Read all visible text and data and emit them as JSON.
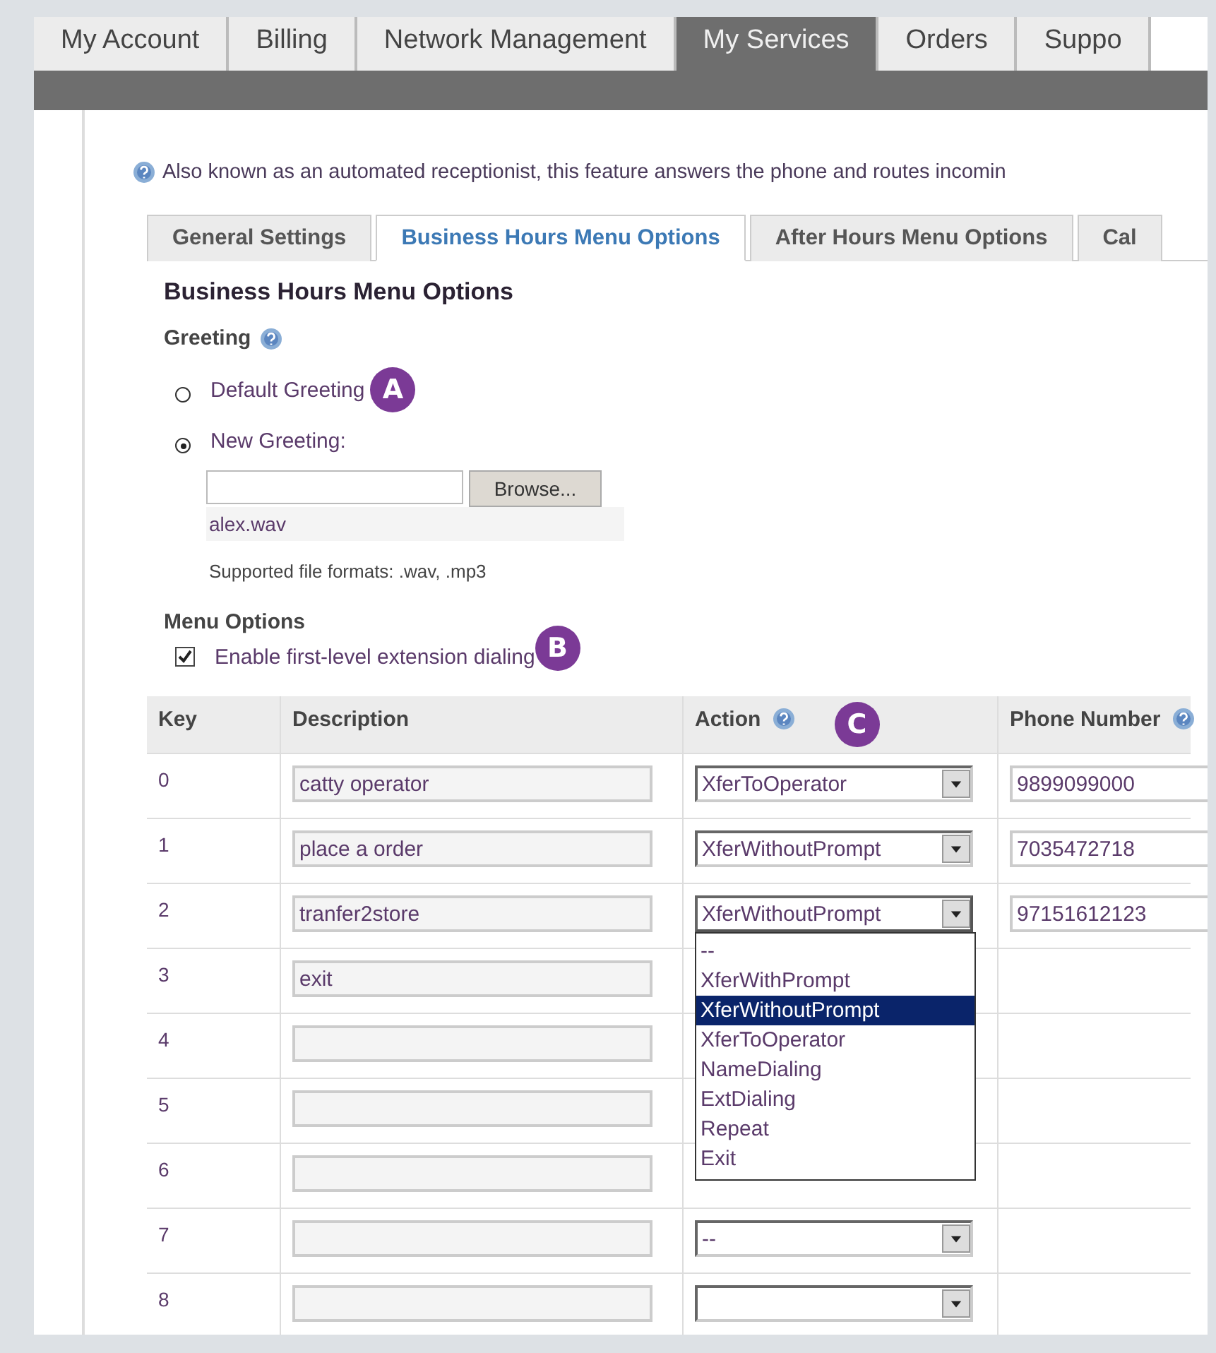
{
  "nav_tabs": [
    {
      "label": "My Account",
      "selected": false
    },
    {
      "label": "Billing",
      "selected": false
    },
    {
      "label": "Network Management",
      "selected": false
    },
    {
      "label": "My Services",
      "selected": true
    },
    {
      "label": "Orders",
      "selected": false
    },
    {
      "label": "Suppo",
      "selected": false
    }
  ],
  "info": "Also known as an automated receptionist, this feature answers the phone and routes incomin",
  "sub_tabs": [
    {
      "label": "General Settings",
      "selected": false
    },
    {
      "label": "Business Hours Menu Options",
      "selected": true
    },
    {
      "label": "After Hours Menu Options",
      "selected": false
    },
    {
      "label": "Cal",
      "selected": false
    }
  ],
  "section_title": "Business Hours Menu Options",
  "greeting": {
    "label": "Greeting",
    "options": [
      {
        "label": "Default Greeting",
        "selected": false,
        "callout": "A"
      },
      {
        "label": "New Greeting:",
        "selected": true
      }
    ],
    "browse_button": "Browse...",
    "file_name": "alex.wav",
    "note": "Supported file formats: .wav, .mp3"
  },
  "menu_options": {
    "label": "Menu Options",
    "checkbox": {
      "label": "Enable first-level extension dialing",
      "checked": true,
      "callout": "B"
    }
  },
  "table": {
    "columns": [
      {
        "label": "Key"
      },
      {
        "label": "Description"
      },
      {
        "label": "Action",
        "help": true,
        "callout": "C"
      },
      {
        "label": "Phone Number",
        "help": true
      }
    ],
    "rows": [
      {
        "key": "0",
        "description": "catty operator",
        "action": "XferToOperator",
        "phone": "9899099000"
      },
      {
        "key": "1",
        "description": "place a order",
        "action": "XferWithoutPrompt",
        "phone": "7035472718"
      },
      {
        "key": "2",
        "description": "tranfer2store",
        "action": "XferWithoutPrompt",
        "phone": "97151612123",
        "open": true
      },
      {
        "key": "3",
        "description": "exit"
      },
      {
        "key": "4",
        "description": ""
      },
      {
        "key": "5",
        "description": ""
      },
      {
        "key": "6",
        "description": ""
      },
      {
        "key": "7",
        "description": "",
        "action": "--"
      },
      {
        "key": "8",
        "description": "",
        "action": ""
      }
    ]
  },
  "dropdown": [
    {
      "label": "--",
      "selected": false
    },
    {
      "label": "XferWithPrompt",
      "selected": false
    },
    {
      "label": "XferWithoutPrompt",
      "selected": true
    },
    {
      "label": "XferToOperator",
      "selected": false
    },
    {
      "label": "NameDialing",
      "selected": false
    },
    {
      "label": "ExtDialing",
      "selected": false
    },
    {
      "label": "Repeat",
      "selected": false
    },
    {
      "label": "Exit",
      "selected": false
    }
  ]
}
